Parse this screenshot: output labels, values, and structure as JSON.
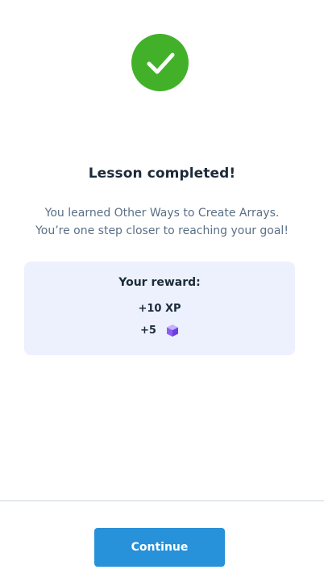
{
  "status_icon": "checkmark-circle-icon",
  "title": "Lesson completed!",
  "message": {
    "line1": "You learned Other Ways to Create Arrays.",
    "line2": "You’re one step closer to reaching your goal!"
  },
  "reward": {
    "heading": "Your reward:",
    "xp": "+10 XP",
    "bits": "+5",
    "bits_icon": "purple-cube-icon"
  },
  "continue_label": "Continue",
  "colors": {
    "success": "#43b02a",
    "primary": "#2791d9",
    "card_bg": "#edf1fd",
    "cube": "#8b5cf6"
  }
}
